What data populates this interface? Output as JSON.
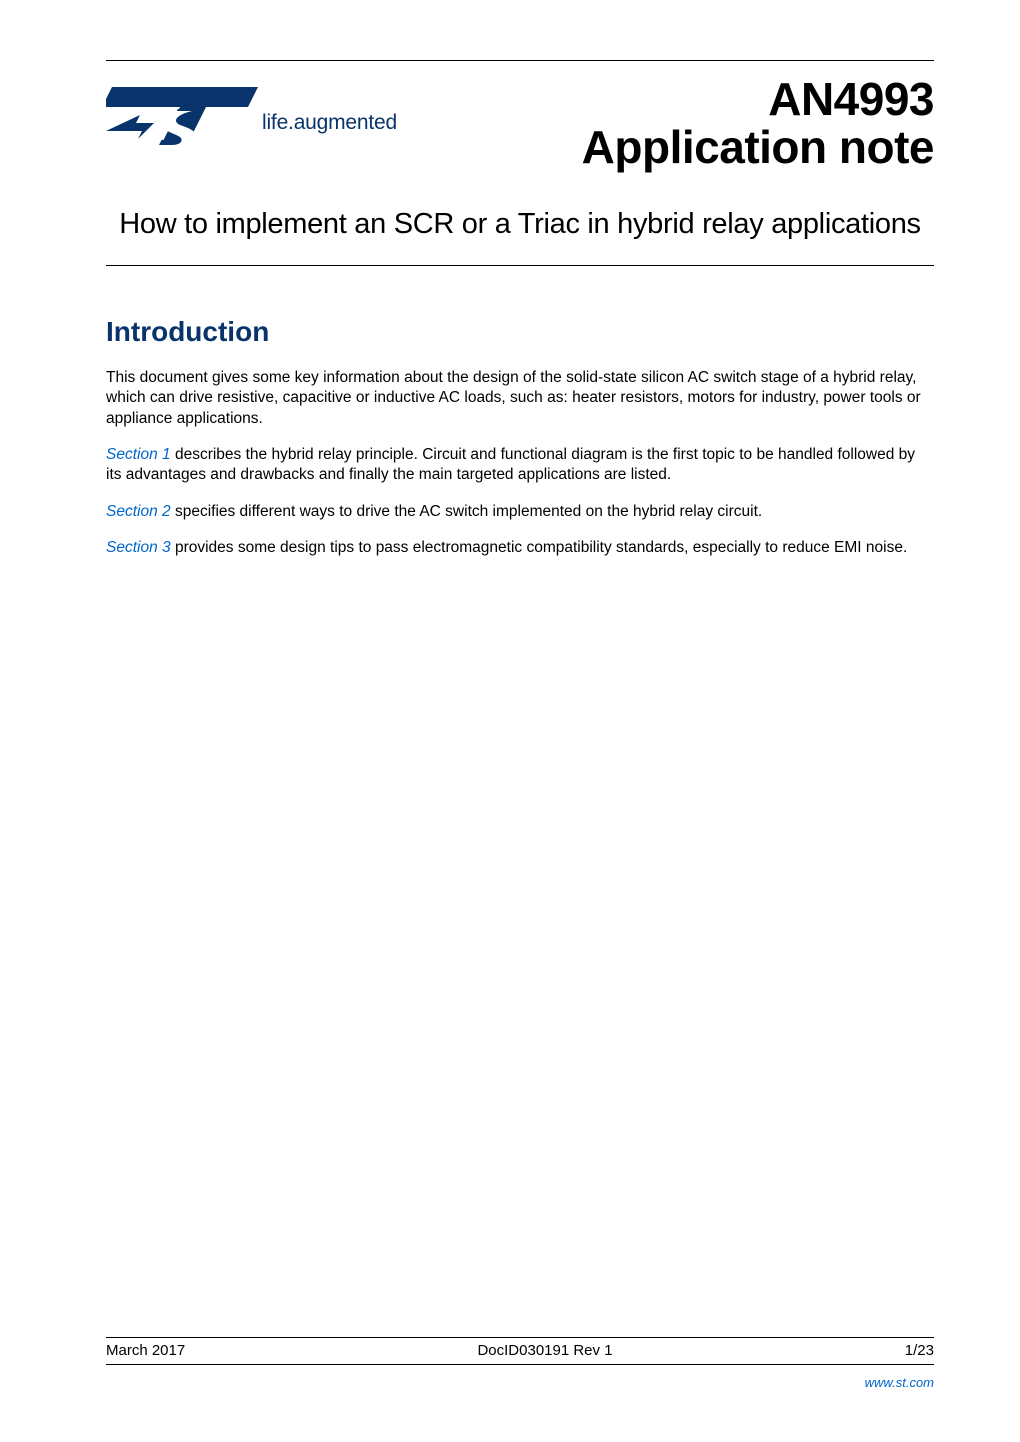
{
  "header": {
    "tagline_a": "life",
    "tagline_b": "augmented",
    "doc_number": "AN4993",
    "doc_type": "Application note"
  },
  "title": "How to implement an SCR or a Triac in hybrid relay applications",
  "intro": {
    "heading": "Introduction",
    "para1": "This document gives some key information about the design of the solid-state silicon AC switch stage of a hybrid relay, which can drive resistive, capacitive or inductive AC loads, such as: heater resistors, motors for industry, power tools or appliance applications.",
    "para2_link": "Section 1",
    "para2_rest": " describes the hybrid relay principle. Circuit and functional diagram is the first topic to be handled followed by its advantages and drawbacks and finally the main targeted applications are listed.",
    "para3_link": "Section 2",
    "para3_rest": " specifies different ways to drive the AC switch implemented on the hybrid relay circuit.",
    "para4_link": "Section 3",
    "para4_rest": " provides some design tips to pass electromagnetic compatibility standards, especially to reduce EMI noise."
  },
  "footer": {
    "date": "March 2017",
    "docid": "DocID030191 Rev 1",
    "page": "1/23",
    "url": "www.st.com"
  },
  "colors": {
    "brand_blue": "#08346b",
    "link_blue": "#0066cc"
  }
}
